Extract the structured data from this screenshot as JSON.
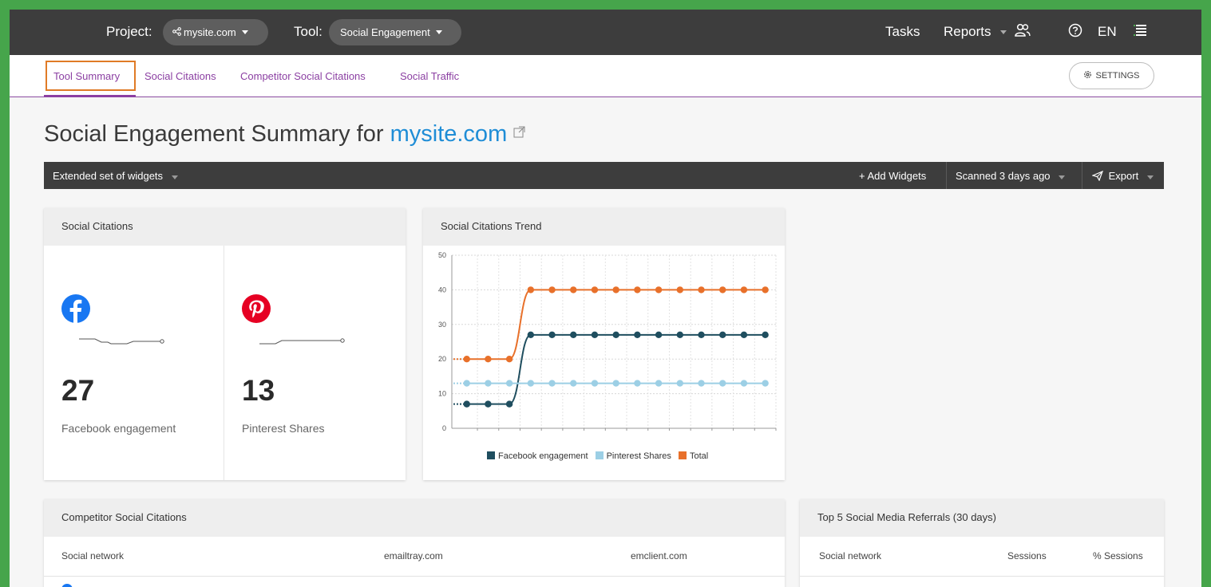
{
  "topbar": {
    "project_label": "Project:",
    "project_value": "mysite.com",
    "tool_label": "Tool:",
    "tool_value": "Social Engagement",
    "tasks": "Tasks",
    "reports": "Reports",
    "lang": "EN",
    "icons": [
      "share-icon",
      "team-icon",
      "help-icon",
      "menu-icon"
    ]
  },
  "tabs": [
    {
      "label": "Tool Summary",
      "active": true
    },
    {
      "label": "Social Citations"
    },
    {
      "label": "Competitor Social Citations"
    },
    {
      "label": "Social Traffic"
    }
  ],
  "settings_label": "SETTINGS",
  "title": {
    "prefix": "Social Engagement Summary for ",
    "site": "mysite.com"
  },
  "widget_bar": {
    "set_label": "Extended set of widgets",
    "add": "+ Add Widgets",
    "scanned": "Scanned 3 days ago",
    "export": "Export"
  },
  "social_citations": {
    "title": "Social Citations",
    "facebook": {
      "value": "27",
      "label": "Facebook engagement"
    },
    "pinterest": {
      "value": "13",
      "label": "Pinterest Shares"
    }
  },
  "trend": {
    "title": "Social Citations Trend",
    "legend": [
      "Facebook engagement",
      "Pinterest Shares",
      "Total"
    ]
  },
  "chart_data": {
    "type": "line",
    "title": "Social Citations Trend",
    "ylim": [
      0,
      50
    ],
    "yticks": [
      "0",
      "10",
      "20",
      "30",
      "40",
      "50"
    ],
    "grid": true,
    "legend_position": "bottom",
    "series": [
      {
        "name": "Facebook engagement",
        "color": "#1f4e5f",
        "values": [
          7,
          7,
          7,
          27,
          27,
          27,
          27,
          27,
          27,
          27,
          27,
          27,
          27,
          27,
          27
        ]
      },
      {
        "name": "Pinterest Shares",
        "color": "#9ccfe5",
        "values": [
          13,
          13,
          13,
          13,
          13,
          13,
          13,
          13,
          13,
          13,
          13,
          13,
          13,
          13,
          13
        ]
      },
      {
        "name": "Total",
        "color": "#e8702a",
        "values": [
          20,
          20,
          20,
          40,
          40,
          40,
          40,
          40,
          40,
          40,
          40,
          40,
          40,
          40,
          40
        ]
      }
    ]
  },
  "competitor": {
    "title": "Competitor Social Citations",
    "columns": [
      "Social network",
      "emailtray.com",
      "emclient.com"
    ]
  },
  "referrals": {
    "title": "Top 5 Social Media Referrals (30 days)",
    "columns": [
      "Social network",
      "Sessions",
      "% Sessions"
    ]
  }
}
